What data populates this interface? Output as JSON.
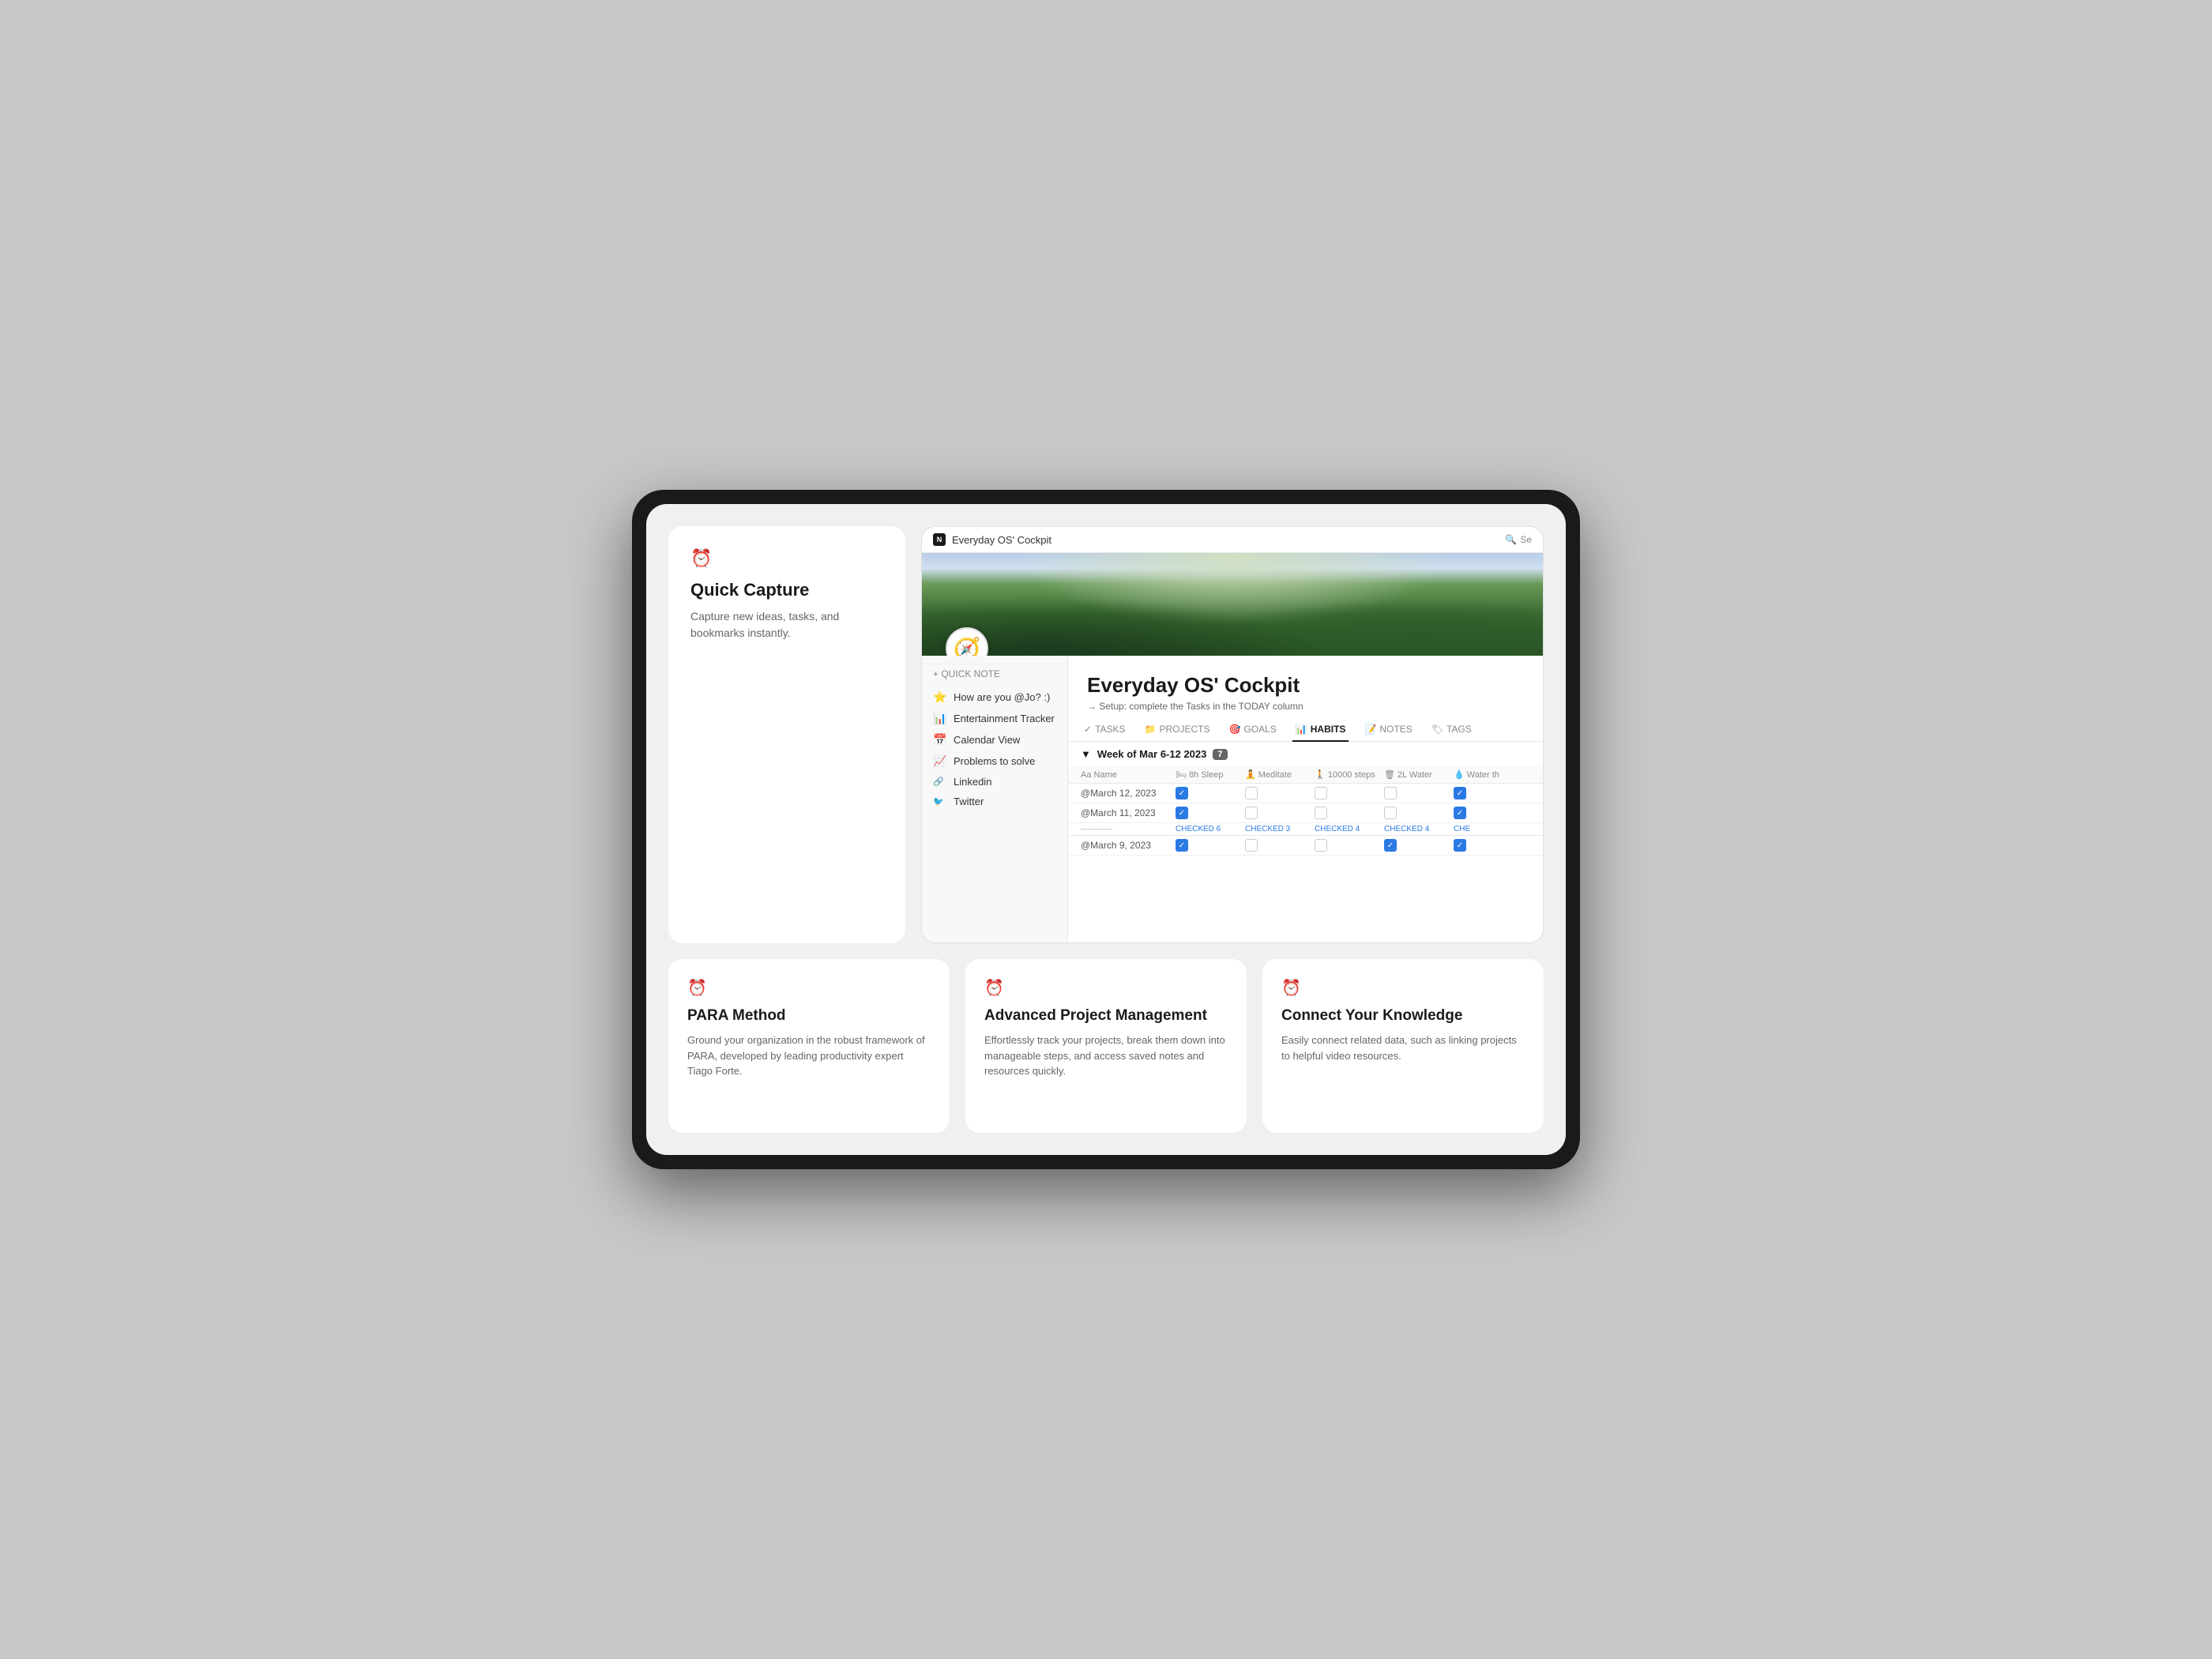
{
  "device": {
    "background": "#c0c0c0"
  },
  "quick_capture": {
    "icon": "⏰",
    "title": "Quick Capture",
    "description": "Capture new ideas, tasks, and bookmarks instantly."
  },
  "notion": {
    "header": {
      "title": "Everyday OS' Cockpit",
      "search_label": "Se"
    },
    "page": {
      "title": "Everyday OS' Cockpit",
      "subtitle": "→ Setup: complete the Tasks in the TODAY column"
    },
    "sidebar": {
      "quick_note": "+ QUICK NOTE",
      "items": [
        {
          "emoji": "⭐",
          "label": "How are you @Jo? :)"
        },
        {
          "emoji": "📊",
          "label": "Entertainment Tracker"
        },
        {
          "emoji": "📅",
          "label": "Calendar View"
        },
        {
          "emoji": "📈",
          "label": "Problems to solve"
        },
        {
          "emoji": "🔗",
          "label": "Linkedin",
          "social": true
        },
        {
          "emoji": "🐦",
          "label": "Twitter",
          "social": true
        }
      ]
    },
    "tabs": [
      {
        "label": "TASKS",
        "icon": "✓",
        "active": false
      },
      {
        "label": "PROJECTS",
        "icon": "📁",
        "active": false
      },
      {
        "label": "GOALS",
        "icon": "🎯",
        "active": false
      },
      {
        "label": "HABITS",
        "icon": "📊",
        "active": true
      },
      {
        "label": "NOTES",
        "icon": "📝",
        "active": false
      },
      {
        "label": "TAGS",
        "icon": "🏷",
        "active": false
      }
    ],
    "habits": {
      "week_label": "Week of Mar 6-12 2023",
      "week_count": "7",
      "columns": [
        "Aa Name",
        "🛏 8h Sleep",
        "🧘 Meditate",
        "🚶 10000 steps",
        "🗑 2L Water",
        "💧 Water th"
      ],
      "rows": [
        {
          "date": "@March 12, 2023",
          "sleep": true,
          "meditate": false,
          "steps": false,
          "water": false,
          "waterth": true
        },
        {
          "date": "@March 11, 2023",
          "sleep": true,
          "meditate": false,
          "steps": false,
          "water": false,
          "waterth": true
        }
      ],
      "checked_row": {
        "sleep": "CHECKED 6",
        "meditate": "CHECKED 3",
        "steps": "CHECKED 4",
        "water": "CHECKED 4",
        "waterth": "CHE"
      },
      "row_march9": {
        "date": "@March 9, 2023",
        "sleep": true,
        "meditate": false,
        "steps": false,
        "water": true,
        "waterth": true
      }
    }
  },
  "feature_cards": [
    {
      "icon": "⏰",
      "title": "PARA Method",
      "description": "Ground your organization in the robust framework of PARA, developed by leading productivity expert Tiago Forte."
    },
    {
      "icon": "⏰",
      "title": "Advanced Project Management",
      "description": "Effortlessly track your projects, break them down into manageable steps, and access saved notes and resources quickly."
    },
    {
      "icon": "⏰",
      "title": "Connect Your Knowledge",
      "description": "Easily connect related data, such as linking projects to helpful video resources."
    }
  ]
}
